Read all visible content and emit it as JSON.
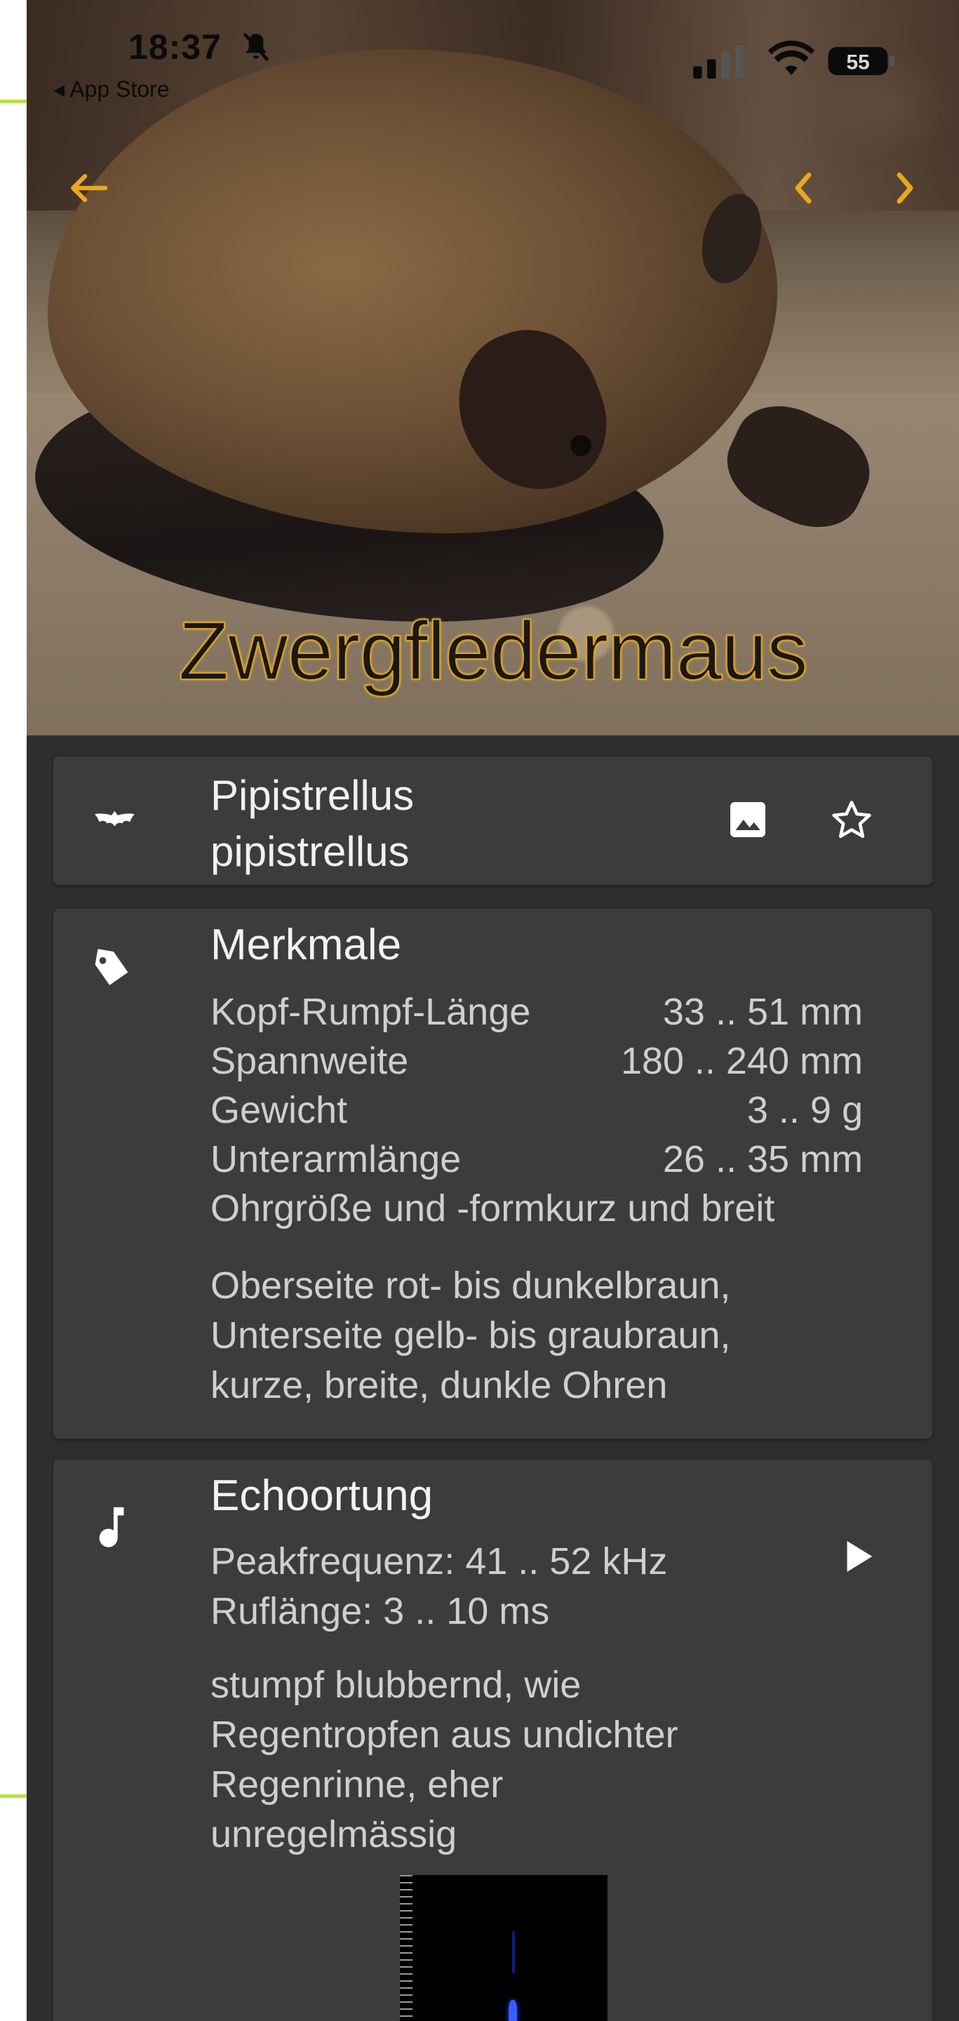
{
  "status_bar": {
    "time": "18:37",
    "back_to_app": "◂ App Store",
    "battery": "55"
  },
  "colors": {
    "accent": "#e7a81d",
    "card_bg": "#3c3c3c",
    "page_bg": "#2e2e2e"
  },
  "header": {
    "title": "Zwergfledermaus"
  },
  "species": {
    "scientific_name_line1": "Pipistrellus",
    "scientific_name_line2": "pipistrellus"
  },
  "features": {
    "heading": "Merkmale",
    "rows": [
      {
        "label": "Kopf-Rumpf-Länge",
        "value": "33 .. 51 mm"
      },
      {
        "label": "Spannweite",
        "value": "180 .. 240 mm"
      },
      {
        "label": "Gewicht",
        "value": "3 .. 9 g"
      },
      {
        "label": "Unterarmlänge",
        "value": "26 .. 35 mm"
      },
      {
        "label": "Ohrgröße und -form",
        "value": "kurz und breit"
      }
    ],
    "description_lines": [
      "Oberseite rot- bis dunkelbraun,",
      "Unterseite gelb- bis graubraun,",
      "kurze, breite, dunkle Ohren"
    ]
  },
  "echolocation": {
    "heading": "Echoortung",
    "peak_frequency": "Peakfrequenz: 41 .. 52 kHz",
    "call_length": "Ruflänge: 3 .. 10 ms",
    "description_lines": [
      "stumpf blubbernd, wie",
      "Regentropfen aus undichter",
      "Regenrinne, eher",
      "unregelmässig"
    ]
  },
  "icons": {
    "back": "arrow-left-icon",
    "prev": "chevron-left-icon",
    "next": "chevron-right-icon",
    "bat": "bat-icon",
    "image": "image-icon",
    "star": "star-outline-icon",
    "tag": "tag-icon",
    "music": "music-note-icon",
    "play": "play-icon"
  }
}
